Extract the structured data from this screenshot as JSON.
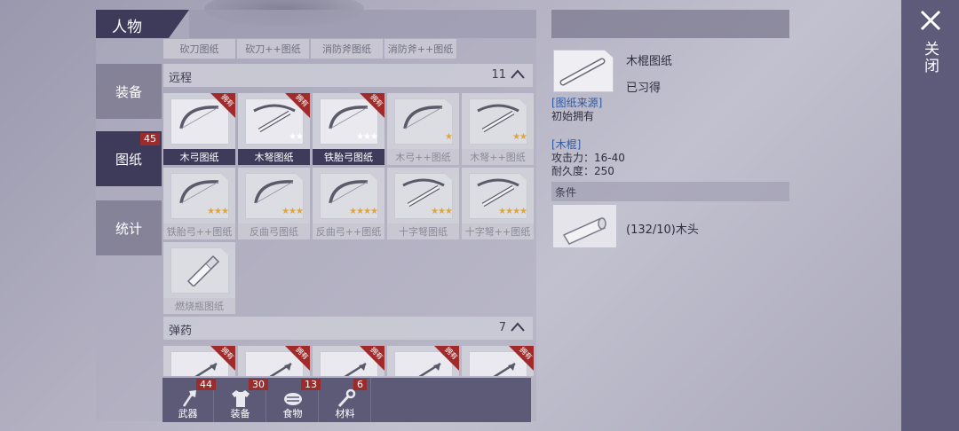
{
  "panel": {
    "title": "人物"
  },
  "side_tabs": [
    {
      "label": "装备",
      "badge": ""
    },
    {
      "label": "图纸",
      "badge": "45"
    },
    {
      "label": "统计",
      "badge": ""
    }
  ],
  "prev_row": [
    "砍刀图纸",
    "砍刀++图纸",
    "消防斧图纸",
    "消防斧++图纸"
  ],
  "sections": {
    "ranged": {
      "title": "远程",
      "count": "11"
    },
    "ammo": {
      "title": "弹药",
      "count": "7"
    }
  },
  "owned_ribbon": "拥有",
  "ranged_items": [
    {
      "label": "木弓图纸",
      "owned": true,
      "stars": "",
      "locked": false,
      "icon": "bow-icon"
    },
    {
      "label": "木弩图纸",
      "owned": true,
      "stars": "★★",
      "locked": false,
      "icon": "crossbow-icon"
    },
    {
      "label": "铁胎弓图纸",
      "owned": true,
      "stars": "★★★",
      "locked": false,
      "icon": "bow-icon"
    },
    {
      "label": "木弓++图纸",
      "owned": false,
      "stars": "★",
      "locked": true,
      "icon": "bow-icon"
    },
    {
      "label": "木弩++图纸",
      "owned": false,
      "stars": "★★",
      "locked": true,
      "icon": "crossbow-icon"
    },
    {
      "label": "铁胎弓++图纸",
      "owned": false,
      "stars": "★★★",
      "locked": true,
      "icon": "bow-icon"
    },
    {
      "label": "反曲弓图纸",
      "owned": false,
      "stars": "★★★",
      "locked": true,
      "icon": "bow-icon"
    },
    {
      "label": "反曲弓++图纸",
      "owned": false,
      "stars": "★★★★",
      "locked": true,
      "icon": "bow-icon"
    },
    {
      "label": "十字弩图纸",
      "owned": false,
      "stars": "★★★",
      "locked": true,
      "icon": "crossbow-icon"
    },
    {
      "label": "十字弩++图纸",
      "owned": false,
      "stars": "★★★★",
      "locked": true,
      "icon": "crossbow-icon"
    },
    {
      "label": "燃烧瓶图纸",
      "owned": false,
      "stars": "",
      "locked": true,
      "icon": "bottle-icon"
    }
  ],
  "bottom_bar": [
    {
      "label": "武器",
      "badge": "44",
      "icon": "axe-icon"
    },
    {
      "label": "装备",
      "badge": "30",
      "icon": "shirt-icon"
    },
    {
      "label": "食物",
      "badge": "13",
      "icon": "food-icon"
    },
    {
      "label": "材料",
      "badge": "6",
      "icon": "wrench-icon"
    }
  ],
  "detail": {
    "title": "木棍图纸",
    "status": "已习得",
    "source_label": "[图纸来源]",
    "source_value": "初始拥有",
    "item_label": "[木棍]",
    "attack": "攻击力：16-40",
    "durability": "耐久度：250",
    "condition_header": "条件",
    "condition_text": "(132/10)木头"
  },
  "close": {
    "label": "关闭"
  },
  "colors": {
    "panel_dark": "#3e3a5a",
    "badge_red": "#9c2c2c",
    "star_gold": "#e0a53a",
    "link_blue": "#2d5aa3"
  }
}
